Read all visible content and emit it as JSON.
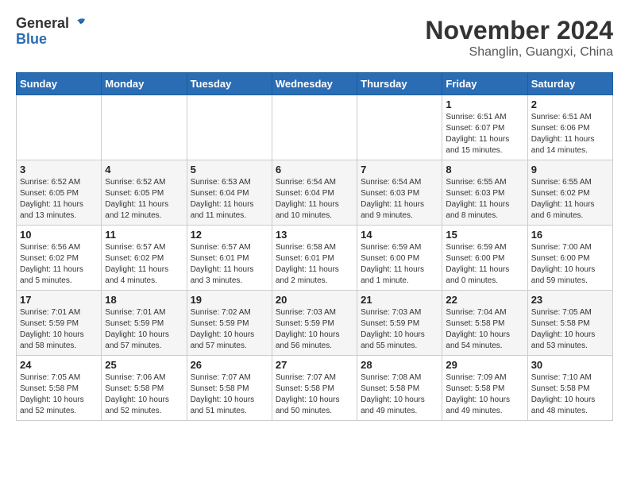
{
  "header": {
    "logo_line1": "General",
    "logo_line2": "Blue",
    "month": "November 2024",
    "location": "Shanglin, Guangxi, China"
  },
  "weekdays": [
    "Sunday",
    "Monday",
    "Tuesday",
    "Wednesday",
    "Thursday",
    "Friday",
    "Saturday"
  ],
  "weeks": [
    [
      {
        "day": "",
        "info": ""
      },
      {
        "day": "",
        "info": ""
      },
      {
        "day": "",
        "info": ""
      },
      {
        "day": "",
        "info": ""
      },
      {
        "day": "",
        "info": ""
      },
      {
        "day": "1",
        "info": "Sunrise: 6:51 AM\nSunset: 6:07 PM\nDaylight: 11 hours and 15 minutes."
      },
      {
        "day": "2",
        "info": "Sunrise: 6:51 AM\nSunset: 6:06 PM\nDaylight: 11 hours and 14 minutes."
      }
    ],
    [
      {
        "day": "3",
        "info": "Sunrise: 6:52 AM\nSunset: 6:05 PM\nDaylight: 11 hours and 13 minutes."
      },
      {
        "day": "4",
        "info": "Sunrise: 6:52 AM\nSunset: 6:05 PM\nDaylight: 11 hours and 12 minutes."
      },
      {
        "day": "5",
        "info": "Sunrise: 6:53 AM\nSunset: 6:04 PM\nDaylight: 11 hours and 11 minutes."
      },
      {
        "day": "6",
        "info": "Sunrise: 6:54 AM\nSunset: 6:04 PM\nDaylight: 11 hours and 10 minutes."
      },
      {
        "day": "7",
        "info": "Sunrise: 6:54 AM\nSunset: 6:03 PM\nDaylight: 11 hours and 9 minutes."
      },
      {
        "day": "8",
        "info": "Sunrise: 6:55 AM\nSunset: 6:03 PM\nDaylight: 11 hours and 8 minutes."
      },
      {
        "day": "9",
        "info": "Sunrise: 6:55 AM\nSunset: 6:02 PM\nDaylight: 11 hours and 6 minutes."
      }
    ],
    [
      {
        "day": "10",
        "info": "Sunrise: 6:56 AM\nSunset: 6:02 PM\nDaylight: 11 hours and 5 minutes."
      },
      {
        "day": "11",
        "info": "Sunrise: 6:57 AM\nSunset: 6:02 PM\nDaylight: 11 hours and 4 minutes."
      },
      {
        "day": "12",
        "info": "Sunrise: 6:57 AM\nSunset: 6:01 PM\nDaylight: 11 hours and 3 minutes."
      },
      {
        "day": "13",
        "info": "Sunrise: 6:58 AM\nSunset: 6:01 PM\nDaylight: 11 hours and 2 minutes."
      },
      {
        "day": "14",
        "info": "Sunrise: 6:59 AM\nSunset: 6:00 PM\nDaylight: 11 hours and 1 minute."
      },
      {
        "day": "15",
        "info": "Sunrise: 6:59 AM\nSunset: 6:00 PM\nDaylight: 11 hours and 0 minutes."
      },
      {
        "day": "16",
        "info": "Sunrise: 7:00 AM\nSunset: 6:00 PM\nDaylight: 10 hours and 59 minutes."
      }
    ],
    [
      {
        "day": "17",
        "info": "Sunrise: 7:01 AM\nSunset: 5:59 PM\nDaylight: 10 hours and 58 minutes."
      },
      {
        "day": "18",
        "info": "Sunrise: 7:01 AM\nSunset: 5:59 PM\nDaylight: 10 hours and 57 minutes."
      },
      {
        "day": "19",
        "info": "Sunrise: 7:02 AM\nSunset: 5:59 PM\nDaylight: 10 hours and 57 minutes."
      },
      {
        "day": "20",
        "info": "Sunrise: 7:03 AM\nSunset: 5:59 PM\nDaylight: 10 hours and 56 minutes."
      },
      {
        "day": "21",
        "info": "Sunrise: 7:03 AM\nSunset: 5:59 PM\nDaylight: 10 hours and 55 minutes."
      },
      {
        "day": "22",
        "info": "Sunrise: 7:04 AM\nSunset: 5:58 PM\nDaylight: 10 hours and 54 minutes."
      },
      {
        "day": "23",
        "info": "Sunrise: 7:05 AM\nSunset: 5:58 PM\nDaylight: 10 hours and 53 minutes."
      }
    ],
    [
      {
        "day": "24",
        "info": "Sunrise: 7:05 AM\nSunset: 5:58 PM\nDaylight: 10 hours and 52 minutes."
      },
      {
        "day": "25",
        "info": "Sunrise: 7:06 AM\nSunset: 5:58 PM\nDaylight: 10 hours and 52 minutes."
      },
      {
        "day": "26",
        "info": "Sunrise: 7:07 AM\nSunset: 5:58 PM\nDaylight: 10 hours and 51 minutes."
      },
      {
        "day": "27",
        "info": "Sunrise: 7:07 AM\nSunset: 5:58 PM\nDaylight: 10 hours and 50 minutes."
      },
      {
        "day": "28",
        "info": "Sunrise: 7:08 AM\nSunset: 5:58 PM\nDaylight: 10 hours and 49 minutes."
      },
      {
        "day": "29",
        "info": "Sunrise: 7:09 AM\nSunset: 5:58 PM\nDaylight: 10 hours and 49 minutes."
      },
      {
        "day": "30",
        "info": "Sunrise: 7:10 AM\nSunset: 5:58 PM\nDaylight: 10 hours and 48 minutes."
      }
    ]
  ]
}
